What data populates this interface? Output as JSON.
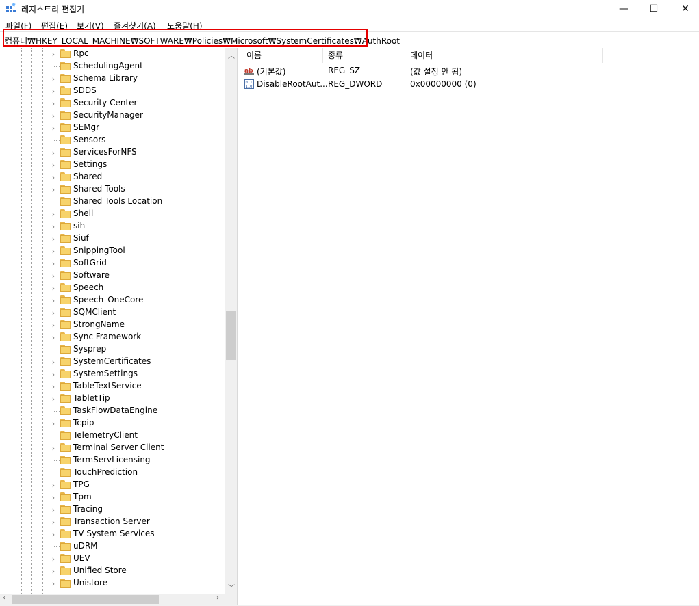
{
  "window": {
    "title": "레지스트리 편집기",
    "controls": {
      "minimize": "—",
      "maximize": "☐",
      "close": "✕"
    }
  },
  "menu": [
    "파일(F)",
    "편집(E)",
    "보기(V)",
    "즐겨찾기(A)",
    "도움말(H)"
  ],
  "address": "컴퓨터₩HKEY_LOCAL_MACHINE₩SOFTWARE₩Policies₩Microsoft₩SystemCertificates₩AuthRoot",
  "highlight_color": "#e50000",
  "tree": {
    "items": [
      {
        "label": "Rpc",
        "expandable": true
      },
      {
        "label": "SchedulingAgent",
        "expandable": false
      },
      {
        "label": "Schema Library",
        "expandable": true
      },
      {
        "label": "SDDS",
        "expandable": true
      },
      {
        "label": "Security Center",
        "expandable": true
      },
      {
        "label": "SecurityManager",
        "expandable": true
      },
      {
        "label": "SEMgr",
        "expandable": true
      },
      {
        "label": "Sensors",
        "expandable": false
      },
      {
        "label": "ServicesForNFS",
        "expandable": true
      },
      {
        "label": "Settings",
        "expandable": true
      },
      {
        "label": "Shared",
        "expandable": true
      },
      {
        "label": "Shared Tools",
        "expandable": true
      },
      {
        "label": "Shared Tools Location",
        "expandable": false
      },
      {
        "label": "Shell",
        "expandable": true
      },
      {
        "label": "sih",
        "expandable": true
      },
      {
        "label": "Siuf",
        "expandable": true
      },
      {
        "label": "SnippingTool",
        "expandable": true
      },
      {
        "label": "SoftGrid",
        "expandable": true
      },
      {
        "label": "Software",
        "expandable": true
      },
      {
        "label": "Speech",
        "expandable": true
      },
      {
        "label": "Speech_OneCore",
        "expandable": true
      },
      {
        "label": "SQMClient",
        "expandable": true
      },
      {
        "label": "StrongName",
        "expandable": true
      },
      {
        "label": "Sync Framework",
        "expandable": true
      },
      {
        "label": "Sysprep",
        "expandable": false
      },
      {
        "label": "SystemCertificates",
        "expandable": true
      },
      {
        "label": "SystemSettings",
        "expandable": true
      },
      {
        "label": "TableTextService",
        "expandable": true
      },
      {
        "label": "TabletTip",
        "expandable": true
      },
      {
        "label": "TaskFlowDataEngine",
        "expandable": false
      },
      {
        "label": "Tcpip",
        "expandable": true
      },
      {
        "label": "TelemetryClient",
        "expandable": false
      },
      {
        "label": "Terminal Server Client",
        "expandable": true
      },
      {
        "label": "TermServLicensing",
        "expandable": false
      },
      {
        "label": "TouchPrediction",
        "expandable": false
      },
      {
        "label": "TPG",
        "expandable": true
      },
      {
        "label": "Tpm",
        "expandable": true
      },
      {
        "label": "Tracing",
        "expandable": true
      },
      {
        "label": "Transaction Server",
        "expandable": true
      },
      {
        "label": "TV System Services",
        "expandable": true
      },
      {
        "label": "uDRM",
        "expandable": false
      },
      {
        "label": "UEV",
        "expandable": true
      },
      {
        "label": "Unified Store",
        "expandable": true
      },
      {
        "label": "Unistore",
        "expandable": true
      }
    ]
  },
  "values": {
    "columns": [
      "이름",
      "종류",
      "데이터"
    ],
    "rows": [
      {
        "icon": "string-value-icon",
        "name": "(기본값)",
        "type": "REG_SZ",
        "data": "(값 설정 안 됨)"
      },
      {
        "icon": "binary-value-icon",
        "name": "DisableRootAut...",
        "type": "REG_DWORD",
        "data": "0x00000000 (0)"
      }
    ]
  }
}
